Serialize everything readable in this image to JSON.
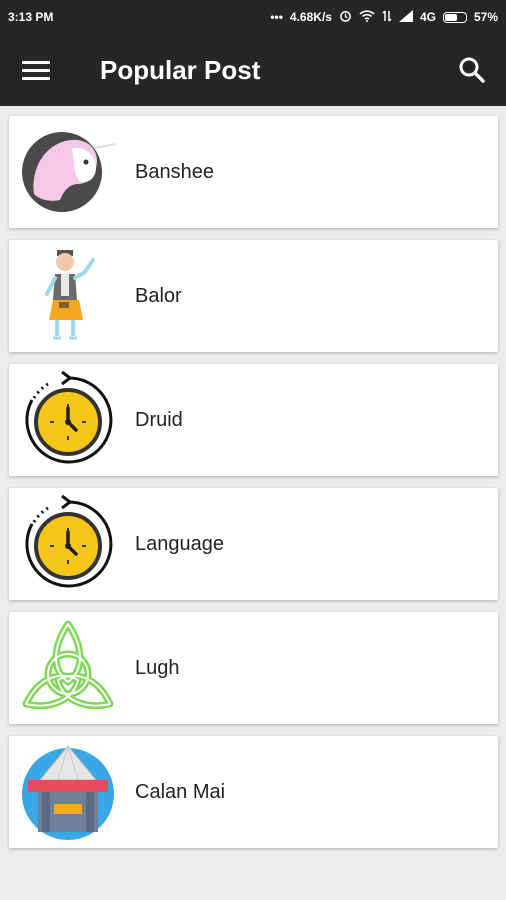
{
  "status_bar": {
    "time": "3:13 PM",
    "network_speed": "4.68K/s",
    "network_type": "4G",
    "battery": "57%"
  },
  "app_bar": {
    "title": "Popular Post",
    "menu_icon": "hamburger-menu-icon",
    "search_icon": "search-icon"
  },
  "posts": [
    {
      "label": "Banshee",
      "icon": "unicorn-icon"
    },
    {
      "label": "Balor",
      "icon": "man-figure-icon"
    },
    {
      "label": "Druid",
      "icon": "clock-history-icon"
    },
    {
      "label": "Language",
      "icon": "clock-history-icon"
    },
    {
      "label": "Lugh",
      "icon": "celtic-knot-icon"
    },
    {
      "label": "Calan Mai",
      "icon": "tent-stall-icon"
    }
  ],
  "colors": {
    "app_bar": "#262626",
    "background": "#ececec",
    "clock_face": "#f5c518",
    "knot": "#7ed957"
  }
}
